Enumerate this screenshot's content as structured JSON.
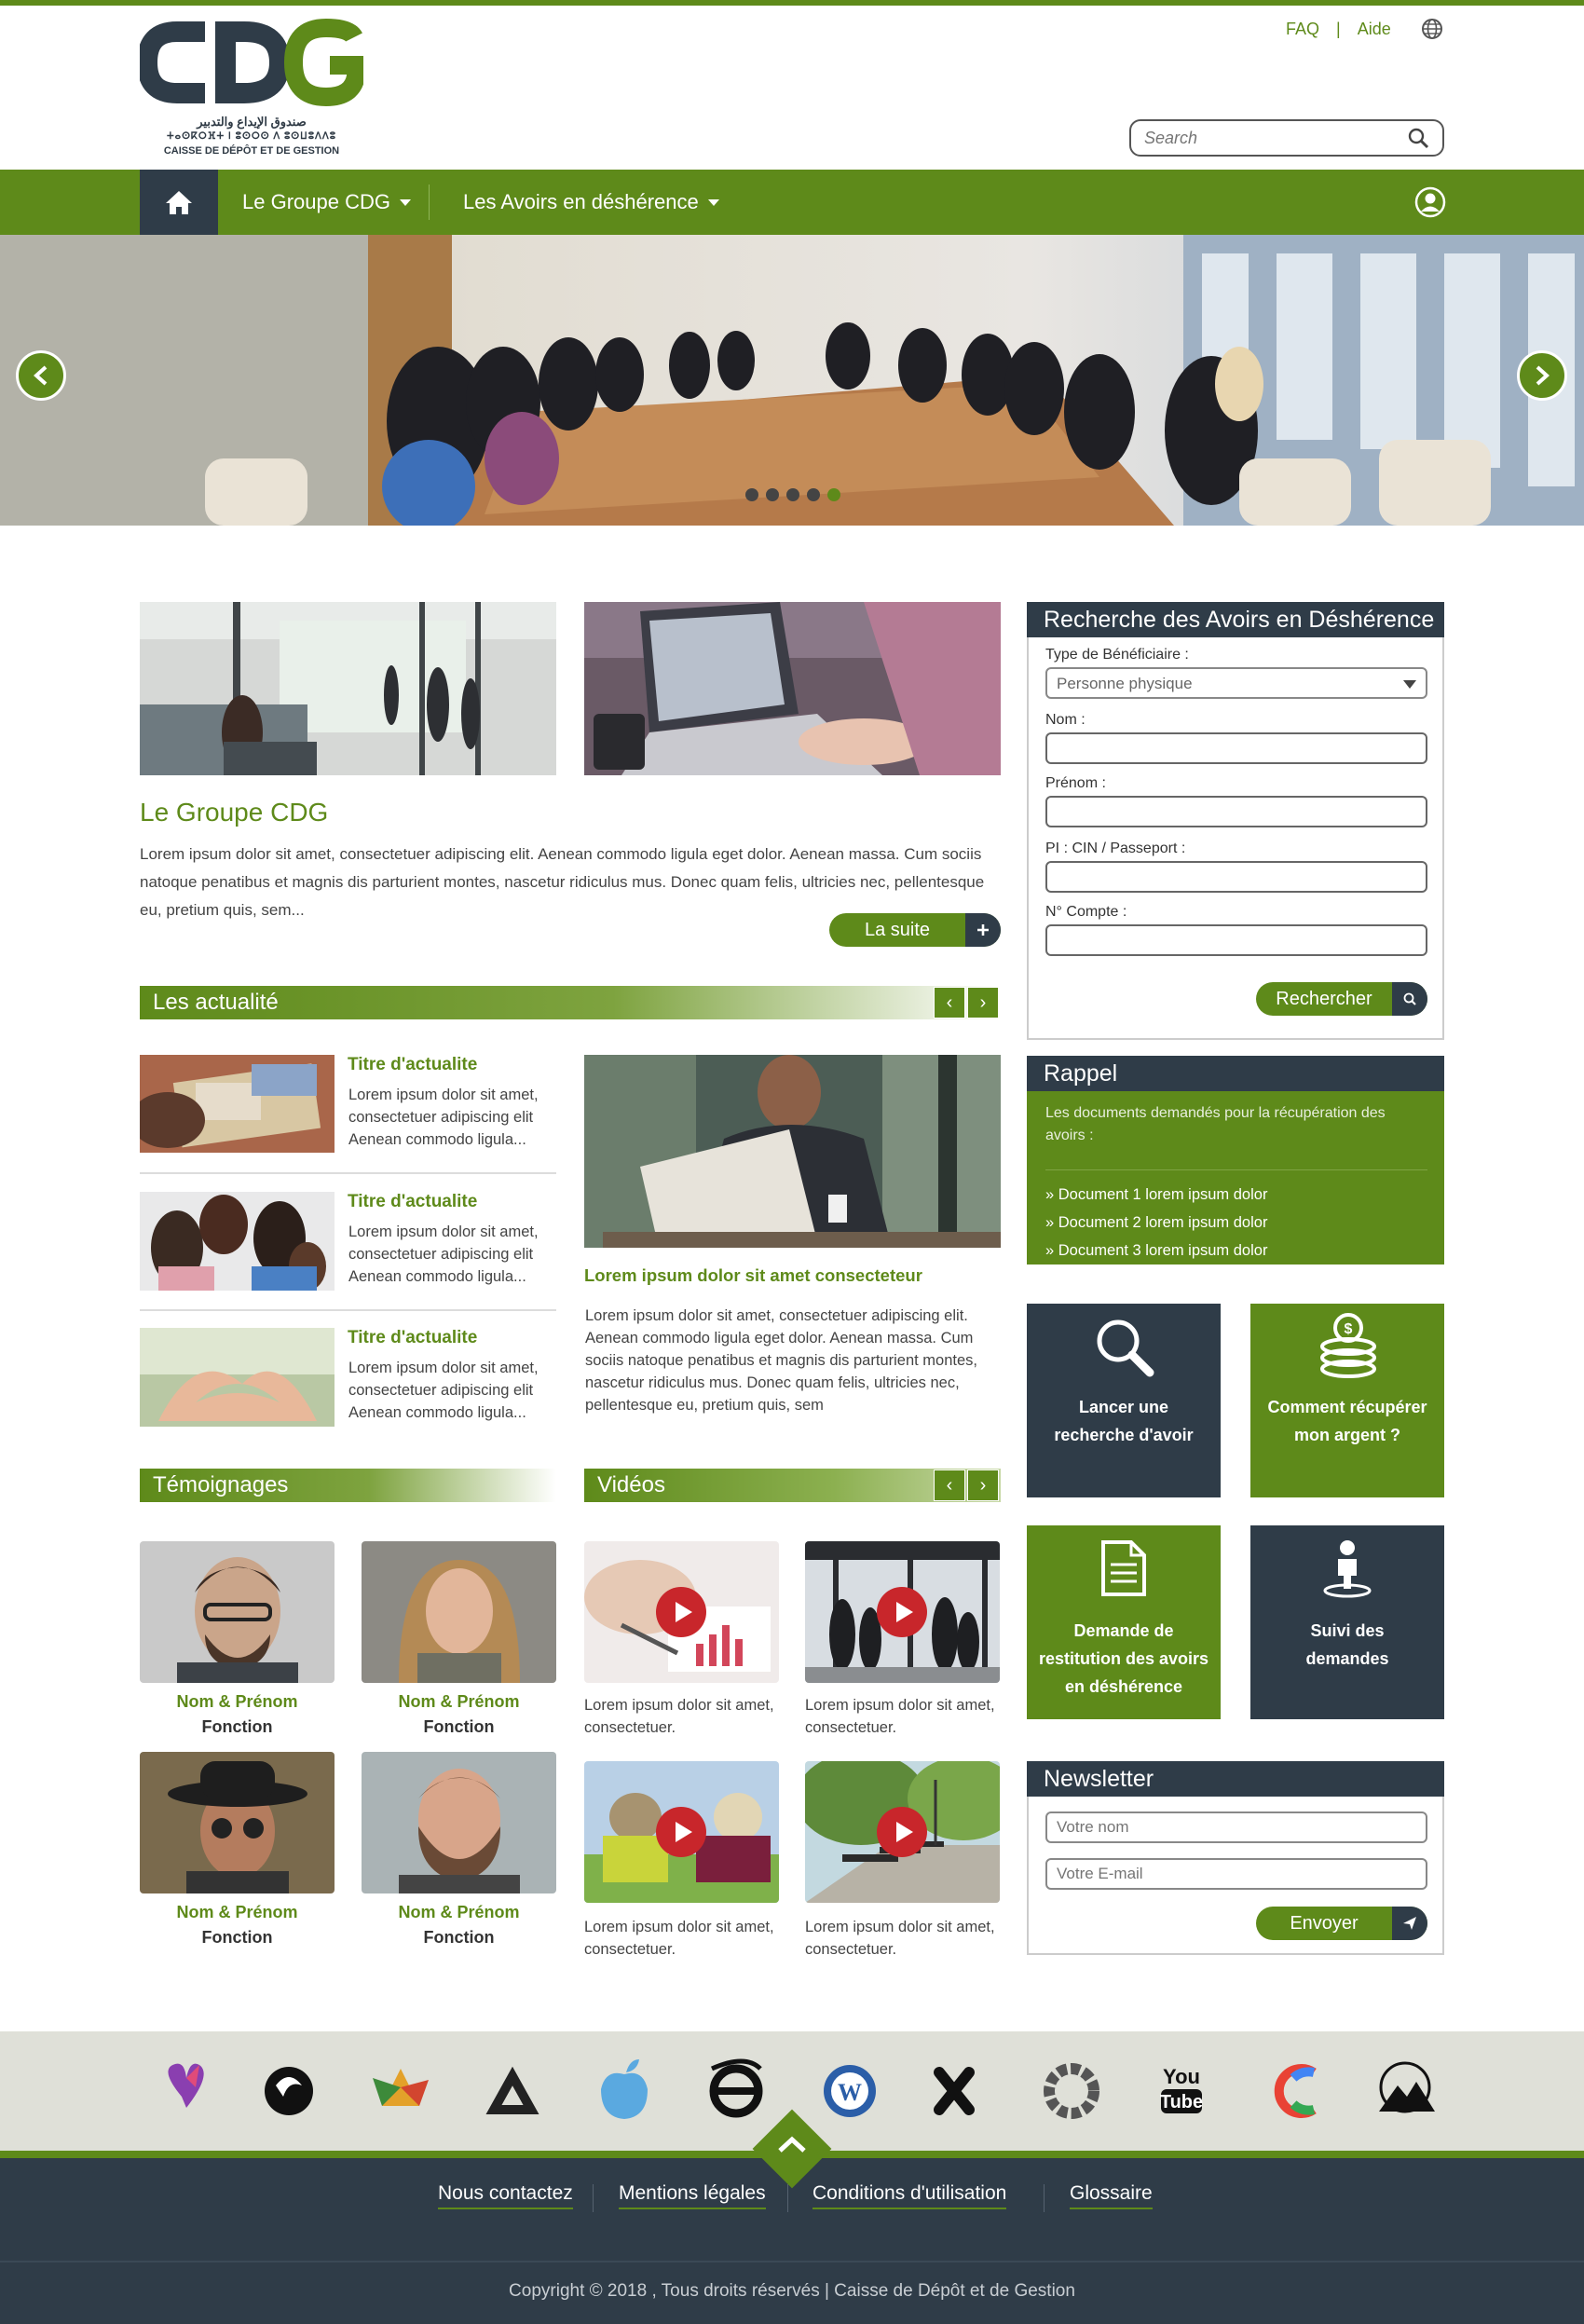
{
  "header": {
    "logo_text": "CDG",
    "logo_arabic": "صندوق الإيداع والتدبير",
    "logo_tifinagh": "ⵜⴰⵙⴽⵔⴼⵜ ⵏ ⵓⵙⵔⵙ ⴷ ⵓⵙⵡⵓⴷⴷⵓ",
    "logo_caption": "CAISSE DE DÉPÔT ET DE GESTION",
    "faq": "FAQ",
    "separator": "|",
    "aide": "Aide",
    "search_placeholder": "Search"
  },
  "nav": {
    "items": [
      {
        "label": "Le Groupe CDG"
      },
      {
        "label": "Les Avoirs en déshérence"
      }
    ]
  },
  "hero": {
    "slides": 5,
    "active_slide": 5
  },
  "groupe": {
    "title": "Le Groupe CDG",
    "text": "Lorem ipsum dolor sit amet, consectetuer adipiscing elit. Aenean commodo ligula eget dolor. Aenean massa. Cum sociis natoque penatibus et magnis dis parturient montes, nascetur ridiculus mus. Donec quam felis, ultricies nec, pellentesque eu, pretium quis, sem...",
    "more_label": "La suite"
  },
  "actualites": {
    "title": "Les actualité",
    "prev": "‹",
    "next": "›",
    "items": [
      {
        "title": "Titre d'actualite",
        "text": "Lorem ipsum dolor sit amet, consectetuer adipiscing elit Aenean commodo ligula..."
      },
      {
        "title": "Titre d'actualite",
        "text": "Lorem ipsum dolor sit amet, consectetuer adipiscing elit Aenean commodo ligula..."
      },
      {
        "title": "Titre d'actualite",
        "text": "Lorem ipsum dolor sit amet, consectetuer adipiscing elit Aenean commodo ligula..."
      }
    ],
    "featured": {
      "title": "Lorem ipsum dolor sit amet consecteteur",
      "text": "Lorem ipsum dolor sit amet, consectetuer adipiscing elit. Aenean commodo ligula eget dolor. Aenean massa. Cum sociis natoque penatibus et magnis dis parturient montes, nascetur ridiculus mus. Donec quam felis, ultricies nec, pellentesque eu, pretium quis, sem"
    }
  },
  "temoignages": {
    "title": "Témoignages",
    "people": [
      {
        "name": "Nom & Prénom",
        "role": "Fonction"
      },
      {
        "name": "Nom & Prénom",
        "role": "Fonction"
      },
      {
        "name": "Nom & Prénom",
        "role": "Fonction"
      },
      {
        "name": "Nom & Prénom",
        "role": "Fonction"
      }
    ]
  },
  "videos": {
    "title": "Vidéos",
    "prev": "‹",
    "next": "›",
    "items": [
      {
        "text": "Lorem ipsum dolor sit amet, consectetuer."
      },
      {
        "text": "Lorem ipsum dolor sit amet, consectetuer."
      },
      {
        "text": "Lorem ipsum dolor sit amet, consectetuer."
      },
      {
        "text": "Lorem ipsum dolor sit amet, consectetuer."
      }
    ]
  },
  "recherche": {
    "title": "Recherche des Avoirs en Déshérence",
    "type_label": "Type de Bénéficiaire :",
    "type_value": "Personne physique",
    "nom_label": "Nom :",
    "prenom_label": "Prénom :",
    "pi_label": "PI : CIN / Passeport :",
    "compte_label": "N° Compte :",
    "submit": "Rechercher"
  },
  "rappel": {
    "title": "Rappel",
    "intro": "Les documents demandés pour la récupération des avoirs :",
    "docs": [
      "Document 1 lorem ipsum dolor",
      "Document 2 lorem ipsum dolor",
      "Document 3 lorem ipsum dolor"
    ]
  },
  "tiles": [
    {
      "label1": "Lancer une",
      "label2": "recherche d'avoir",
      "icon": "magnifier-icon"
    },
    {
      "label1": "Comment récupérer",
      "label2": "mon argent ?",
      "icon": "coins-icon"
    },
    {
      "label1": "Demande de",
      "label2": "restitution des avoirs",
      "label3": "en déshérence",
      "icon": "document-icon"
    },
    {
      "label1": "Suivi des",
      "label2": "demandes",
      "icon": "user-pin-icon"
    }
  ],
  "newsletter": {
    "title": "Newsletter",
    "name_placeholder": "Votre nom",
    "email_placeholder": "Votre E-mail",
    "submit": "Envoyer"
  },
  "footer": {
    "links": [
      "Nous contactez",
      "Mentions légales",
      "Conditions d'utilisation",
      "Glossaire"
    ],
    "copyright": "Copyright © 2018 , Tous droits réservés | Caisse de Dépôt et de Gestion"
  },
  "colors": {
    "green": "#5e8a1a",
    "dark": "#2f3c48",
    "partners_bg": "#dfe0d8"
  }
}
